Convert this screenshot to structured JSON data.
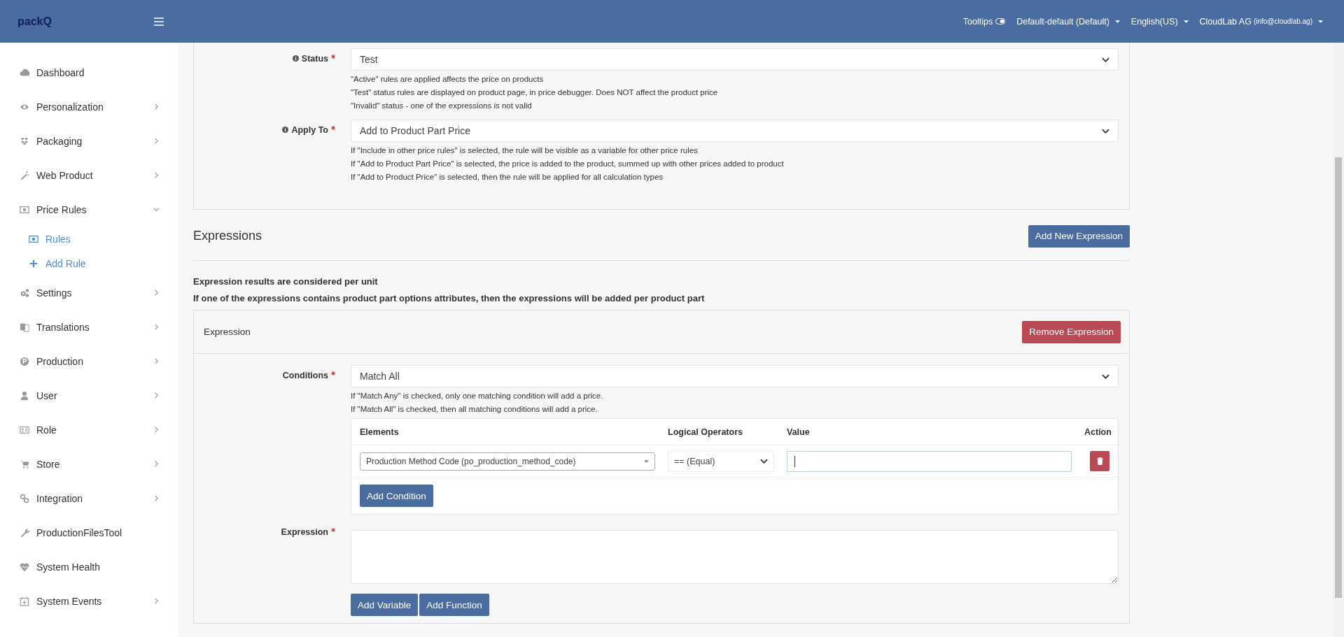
{
  "header": {
    "logo": "packQ",
    "tooltips": {
      "label": "Tooltips"
    },
    "menus": [
      {
        "label": "Default-default (Default)"
      },
      {
        "label": "English(US)"
      },
      {
        "label": "CloudLab AG",
        "sub": "(info@cloudlab.ag)"
      }
    ]
  },
  "sidebar": {
    "items": [
      {
        "label": "Dashboard",
        "kind": "link"
      },
      {
        "label": "Personalization",
        "kind": "group",
        "expanded": false
      },
      {
        "label": "Packaging",
        "kind": "group",
        "expanded": false
      },
      {
        "label": "Web Product",
        "kind": "group",
        "expanded": false
      },
      {
        "label": "Price Rules",
        "kind": "group",
        "expanded": true,
        "children": [
          {
            "label": "Rules"
          },
          {
            "label": "Add Rule"
          }
        ]
      },
      {
        "label": "Settings",
        "kind": "group",
        "expanded": false
      },
      {
        "label": "Translations",
        "kind": "group",
        "expanded": false
      },
      {
        "label": "Production",
        "kind": "group",
        "expanded": false
      },
      {
        "label": "User",
        "kind": "group",
        "expanded": false
      },
      {
        "label": "Role",
        "kind": "group",
        "expanded": false
      },
      {
        "label": "Store",
        "kind": "group",
        "expanded": false
      },
      {
        "label": "Integration",
        "kind": "group",
        "expanded": false
      },
      {
        "label": "ProductionFilesTool",
        "kind": "link"
      },
      {
        "label": "System Health",
        "kind": "link"
      },
      {
        "label": "System Events",
        "kind": "group",
        "expanded": false
      }
    ]
  },
  "rule_form": {
    "fields": [
      {
        "label": "Status",
        "required": true,
        "value": "Test",
        "help": [
          "\"Active\" rules are applied affects the price on products",
          "\"Test\" status rules are displayed on product page, in price debugger. Does NOT affect the product price",
          "\"Invalid\" status - one of the expressions is not valid"
        ]
      },
      {
        "label": "Apply To",
        "required": true,
        "value": "Add to Product Part Price",
        "help": [
          "If \"Include in other price rules\" is selected, the rule will be visible as a variable for other price rules",
          "If \"Add to Product Part Price\" is selected, the price is added to the product, summed up with other prices added to product",
          "If \"Add to Product Price\" is selected, then the rule will be applied for all calculation types"
        ]
      }
    ]
  },
  "expressions": {
    "title": "Expressions",
    "add_button": "Add New Expression",
    "notes": [
      "Expression results are considered per unit",
      "If one of the expressions contains product part options attributes, then the expressions will be added per product part"
    ],
    "card": {
      "title": "Expression",
      "remove_button": "Remove Expression",
      "conditions": {
        "label": "Conditions",
        "required": true,
        "value": "Match All",
        "help": [
          "If \"Match Any\" is checked, only one matching condition will add a price.",
          "If \"Match All\" is checked, then all matching conditions will add a price."
        ]
      },
      "table": {
        "columns": [
          "Elements",
          "Logical Operators",
          "Value",
          "Action"
        ],
        "rows": [
          {
            "element": "Production Method Code (po_production_method_code)",
            "operator": "== (Equal)",
            "focused": true
          }
        ]
      },
      "add_condition": "Add Condition",
      "expression": {
        "label": "Expression",
        "required": true
      },
      "buttons": [
        "Add Variable",
        "Add Function"
      ]
    }
  }
}
